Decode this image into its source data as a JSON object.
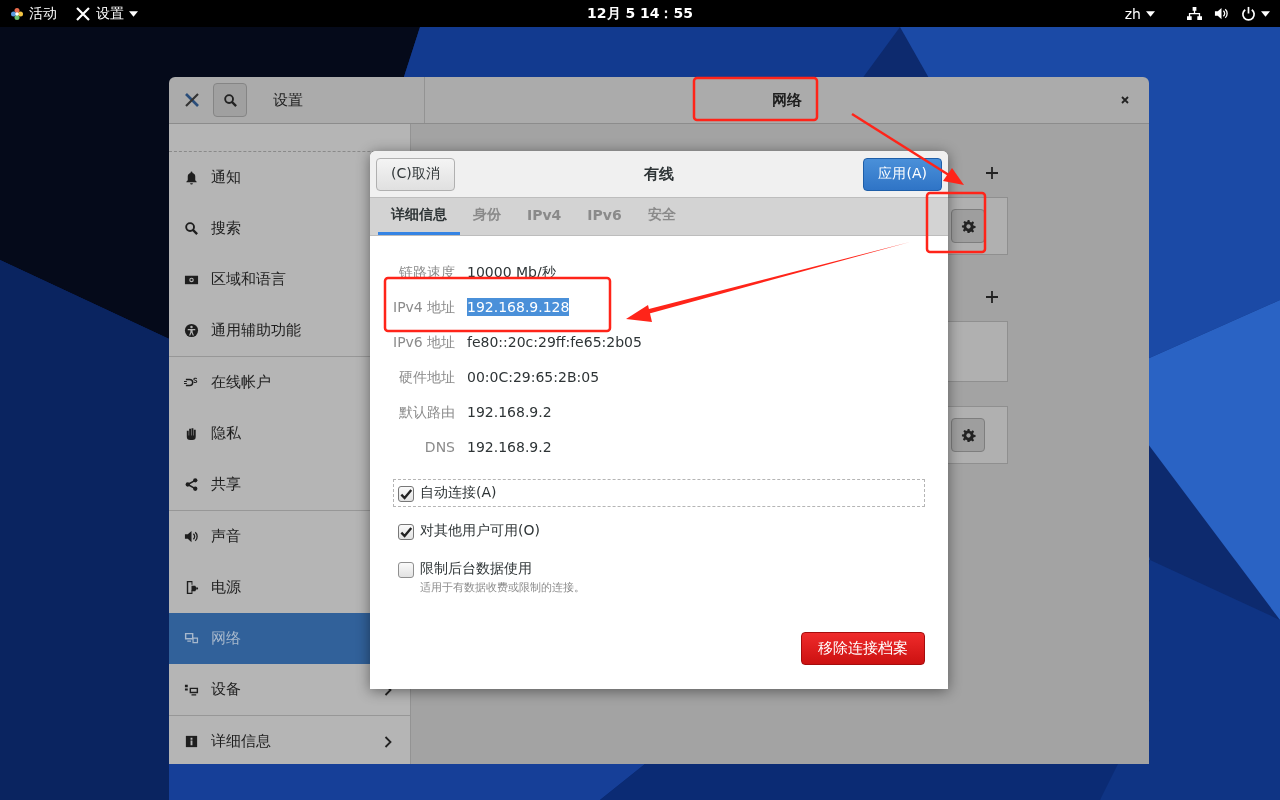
{
  "top_bar": {
    "activities": "活动",
    "app_menu": "设置",
    "clock": "12月 5 14：55",
    "language": "zh"
  },
  "settings_window": {
    "title": "设置",
    "panel_title": "网络",
    "sidebar": {
      "groups": [
        [
          {
            "label": "通知",
            "selected": false
          },
          {
            "label": "搜索",
            "selected": false
          },
          {
            "label": "区域和语言",
            "selected": false
          },
          {
            "label": "通用辅助功能",
            "selected": false
          }
        ],
        [
          {
            "label": "在线帐户",
            "selected": false
          },
          {
            "label": "隐私",
            "selected": false
          },
          {
            "label": "共享",
            "selected": false
          }
        ],
        [
          {
            "label": "声音",
            "selected": false
          },
          {
            "label": "电源",
            "selected": false
          },
          {
            "label": "网络",
            "selected": true
          },
          {
            "label": "设备",
            "selected": false,
            "has_submenu": true
          }
        ],
        [
          {
            "label": "详细信息",
            "selected": false,
            "has_submenu": true
          }
        ]
      ]
    },
    "sections": [
      {
        "can_add": true,
        "cards": [
          {
            "has_settings": true
          }
        ]
      },
      {
        "can_add": true,
        "cards": [
          {
            "has_settings": false
          }
        ]
      },
      {
        "can_add": false,
        "cards": [
          {
            "has_settings": true
          }
        ]
      }
    ]
  },
  "dialog": {
    "title": "有线",
    "cancel_button": "(C)取消",
    "apply_button": "应用(A)",
    "tabs": [
      {
        "label": "详细信息",
        "selected": true
      },
      {
        "label": "身份",
        "selected": false
      },
      {
        "label": "IPv4",
        "selected": false
      },
      {
        "label": "IPv6",
        "selected": false
      },
      {
        "label": "安全",
        "selected": false
      }
    ],
    "details": [
      {
        "label": "链路速度",
        "value": "10000 Mb/秒",
        "highlighted": false
      },
      {
        "label": "IPv4 地址",
        "value": "192.168.9.128",
        "highlighted": true
      },
      {
        "label": "IPv6 地址",
        "value": "fe80::20c:29ff:fe65:2b05",
        "highlighted": false
      },
      {
        "label": "硬件地址",
        "value": "00:0C:29:65:2B:05",
        "highlighted": false
      },
      {
        "label": "默认路由",
        "value": "192.168.9.2",
        "highlighted": false
      },
      {
        "label": "DNS",
        "value": "192.168.9.2",
        "highlighted": false
      }
    ],
    "options": [
      {
        "label": "自动连接(A)",
        "checked": true,
        "focused": true
      },
      {
        "label": "对其他用户可用(O)",
        "checked": true,
        "focused": false
      },
      {
        "label": "限制后台数据使用",
        "checked": false,
        "focused": false,
        "description": "适用于有数据收费或限制的连接。"
      }
    ],
    "remove_button": "移除连接档案"
  }
}
